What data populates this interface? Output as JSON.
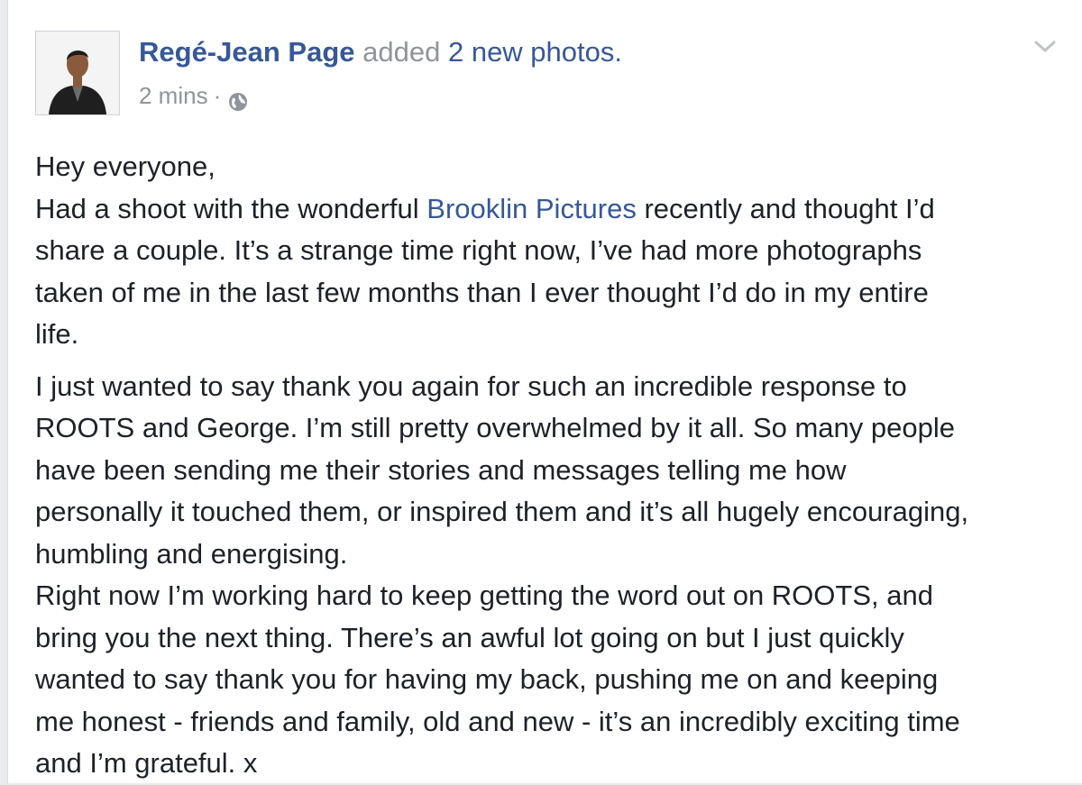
{
  "post": {
    "author": "Regé-Jean Page",
    "action_text": "added",
    "action_link": "2 new photos.",
    "time": "2 mins",
    "separator": "·",
    "privacy_icon": "globe-icon",
    "menu_icon": "chevron-down-icon",
    "avatar_alt": "profile-photo",
    "colors": {
      "link": "#365899",
      "meta": "#90949c",
      "text": "#1d2129"
    }
  },
  "body": {
    "p1_lines": [
      "Hey everyone,"
    ],
    "p1_l2_pre": "Had a shoot with the wonderful ",
    "p1_l2_mention": "Brooklin Pictures",
    "p1_l2_post": " recently and thought I’d",
    "p1_rest": [
      "share a couple. It’s a strange time right now, I’ve had more photographs",
      "taken of me in the last few months than I ever thought I’d do in my entire",
      "life."
    ],
    "p2": [
      "I just wanted to say thank you again for such an incredible response to",
      "ROOTS and George. I’m still pretty overwhelmed by it all. So many people",
      "have been sending me their stories and messages telling me how",
      "personally it touched them, or inspired them and it’s all hugely encouraging,",
      "humbling and energising.",
      "Right now I’m working hard to keep getting the word out on ROOTS, and",
      "bring you the next thing. There’s an awful lot going on but I just quickly",
      "wanted to say thank you for having my back, pushing me on and keeping",
      "me honest - friends and family, old and new - it’s an incredibly exciting time",
      "and I’m grateful. x"
    ]
  }
}
